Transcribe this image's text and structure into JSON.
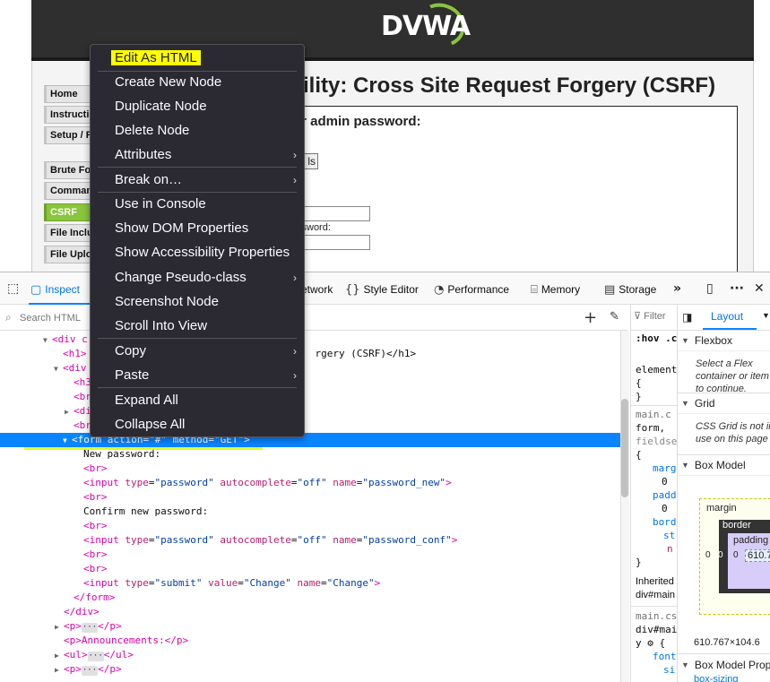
{
  "webpage": {
    "logo_text": "DVWA",
    "menu": [
      "Home",
      "Instructions",
      "Setup / Reset DB",
      "Brute Force",
      "Command Injection",
      "CSRF",
      "File Inclusion",
      "File Upload"
    ],
    "title": "ility: Cross Site Request Forgery (CSRF)",
    "box_heading": "ur admin password:",
    "test_btn_text": "ls",
    "confirm_label": "ssword:"
  },
  "devtools": {
    "tabs": {
      "inspector": "Inspect",
      "network": "etwork",
      "style_editor": "Style Editor",
      "performance": "Performance",
      "memory": "Memory",
      "storage": "Storage"
    },
    "search_placeholder": "Search HTML",
    "filter_placeholder": "Filter",
    "rules_lines": [
      ":hov .cl",
      "element",
      "{",
      "}",
      "main.c",
      "form,",
      "fieldse",
      "{",
      "marg",
      "0",
      "padd",
      "0",
      "bord",
      "st",
      "n",
      "}",
      "Inherited",
      "div#main",
      "main.cs",
      "div#mai",
      "y",
      "font",
      "si"
    ],
    "layout": {
      "tab_label": "Layout",
      "flexbox_label": "Flexbox",
      "flexbox_note": "Select a Flex container or item to continue.",
      "grid_label": "Grid",
      "grid_note": "CSS Grid is not in use on this page",
      "box_model_label": "Box Model",
      "margin_label": "margin",
      "border_label": "border",
      "padding_label": "padding",
      "zero": "0",
      "content_value": "610.7",
      "size_readout": "610.767×104.6",
      "box_model_props_label": "Box Model Prop",
      "box_sizing": "box-sizing"
    }
  },
  "markup": {
    "l1": "<div c",
    "l2_tail": "rgery (CSRF)</h1>",
    "l3": "<div",
    "l4": "<h3",
    "l5": "<br",
    "l6": "<di",
    "l7": "<br",
    "form_tag": "form",
    "form_action_attr": "action",
    "form_action_val": "\"#\"",
    "form_method_attr": "method",
    "form_method_val": "\"GET\"",
    "new_password_text": "New password:",
    "br": "<br>",
    "input": "input",
    "type_attr": "type",
    "password_val": "\"password\"",
    "autocomplete_attr": "autocomplete",
    "off_val": "\"off\"",
    "name_attr": "name",
    "password_new_val": "\"password_new\"",
    "confirm_text": "Confirm new password:",
    "password_conf_val": "\"password_conf\"",
    "submit_val": "\"submit\"",
    "value_attr": "value",
    "change_val": "\"Change\"",
    "form_close": "</form>",
    "div_close": "</div>",
    "p_open": "<p>",
    "p_close": "</p>",
    "announcements": "<p>Announcements:</p>",
    "ul_open": "<ul>",
    "ul_close": "</ul>",
    "ellipsis": "···"
  },
  "context_menu": {
    "items": [
      {
        "label": "Edit As HTML",
        "submenu": false
      },
      {
        "label": "Create New Node",
        "submenu": false
      },
      {
        "label": "Duplicate Node",
        "submenu": false
      },
      {
        "label": "Delete Node",
        "submenu": false
      },
      {
        "label": "Attributes",
        "submenu": true
      },
      {
        "label": "Break on…",
        "submenu": true
      },
      {
        "label": "Use in Console",
        "submenu": false
      },
      {
        "label": "Show DOM Properties",
        "submenu": false
      },
      {
        "label": "Show Accessibility Properties",
        "submenu": false
      },
      {
        "label": "Change Pseudo-class",
        "submenu": true
      },
      {
        "label": "Screenshot Node",
        "submenu": false
      },
      {
        "label": "Scroll Into View",
        "submenu": false
      },
      {
        "label": "Copy",
        "submenu": true
      },
      {
        "label": "Paste",
        "submenu": true
      },
      {
        "label": "Expand All",
        "submenu": false
      },
      {
        "label": "Collapse All",
        "submenu": false
      }
    ]
  },
  "colors": {
    "dvwa_green": "#8ac53e",
    "selection_blue": "#0a84ff",
    "annotation_yellow": "#d7ff00",
    "menu_bg": "#2b2a33"
  }
}
